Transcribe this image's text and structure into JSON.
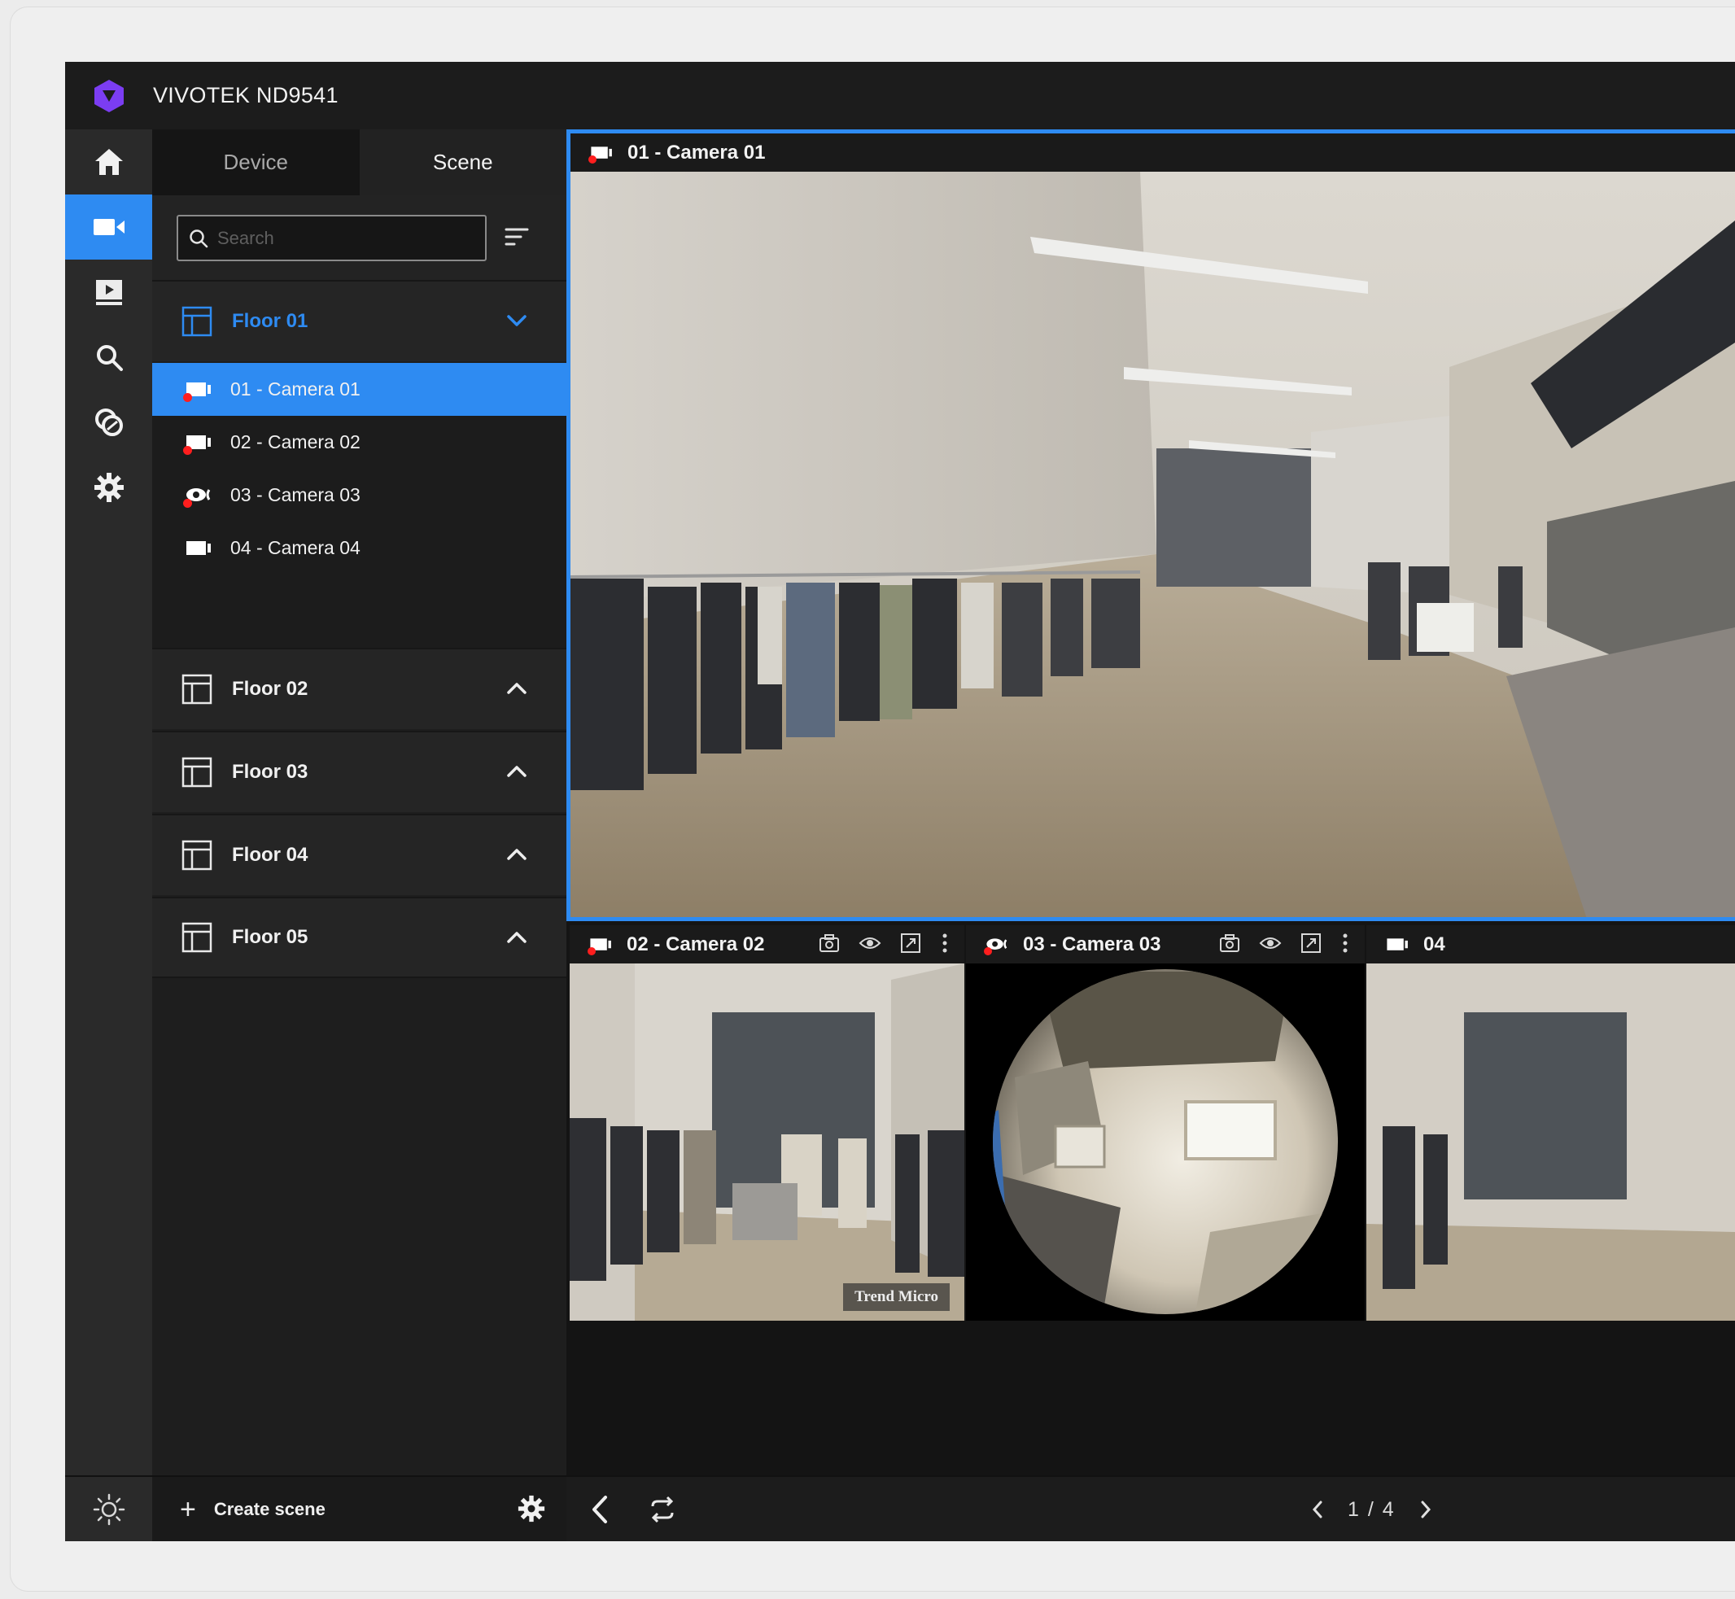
{
  "app": {
    "title": "VIVOTEK ND9541"
  },
  "colors": {
    "accent": "#2e8bf2",
    "recording": "#ff1e1e",
    "logo": "#7b3df2"
  },
  "rail": {
    "items": [
      {
        "name": "home-icon",
        "active": false
      },
      {
        "name": "live-view-icon",
        "active": true
      },
      {
        "name": "playback-icon",
        "active": false
      },
      {
        "name": "search-icon",
        "active": false
      },
      {
        "name": "alarm-icon",
        "active": false
      },
      {
        "name": "settings-gear-icon",
        "active": false
      }
    ],
    "bottom_icon": "theme-sun-icon"
  },
  "panel": {
    "tabs": {
      "device": "Device",
      "scene": "Scene"
    },
    "search_placeholder": "Search",
    "floors": [
      {
        "label": "Floor 01",
        "expanded": true
      },
      {
        "label": "Floor 02",
        "expanded": false
      },
      {
        "label": "Floor 03",
        "expanded": false
      },
      {
        "label": "Floor 04",
        "expanded": false
      },
      {
        "label": "Floor 05",
        "expanded": false
      }
    ],
    "cameras": [
      {
        "label": "01 - Camera 01",
        "selected": true,
        "recording": true,
        "type": "bullet"
      },
      {
        "label": "02 - Camera 02",
        "selected": false,
        "recording": true,
        "type": "bullet"
      },
      {
        "label": "03 - Camera 03",
        "selected": false,
        "recording": true,
        "type": "fisheye"
      },
      {
        "label": "04 - Camera 04",
        "selected": false,
        "recording": false,
        "type": "bullet"
      }
    ],
    "create_scene": "Create scene"
  },
  "tiles": [
    {
      "label": "01 - Camera 01",
      "recording": true
    },
    {
      "label": "02 - Camera 02",
      "recording": true,
      "watermark": "Trend Micro"
    },
    {
      "label": "03 - Camera 03",
      "recording": true
    },
    {
      "label": "04",
      "recording": false
    }
  ],
  "pager": {
    "current": "1",
    "separator": "/",
    "total": "4"
  }
}
